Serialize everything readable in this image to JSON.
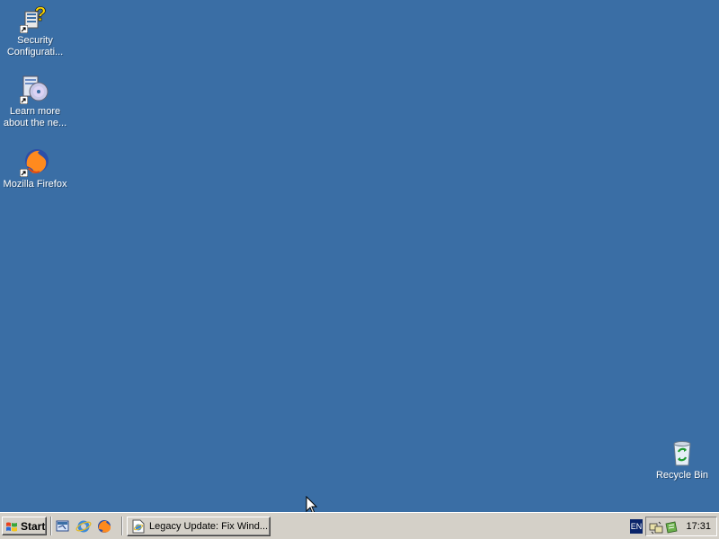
{
  "desktop": {
    "background_color": "#3a6ea5",
    "icons": [
      {
        "label": "Security\nConfigurati...",
        "icon": "security-configuration-wizard-icon"
      },
      {
        "label": "Learn more\nabout the ne...",
        "icon": "learn-more-cd-icon"
      },
      {
        "label": "Mozilla Firefox",
        "icon": "firefox-icon"
      },
      {
        "label": "Recycle Bin",
        "icon": "recycle-bin-icon"
      }
    ]
  },
  "taskbar": {
    "start_label": "Start",
    "quick_launch": [
      "show-desktop-icon",
      "internet-explorer-icon",
      "firefox-icon"
    ],
    "tasks": [
      {
        "label": "Legacy Update: Fix Wind...",
        "icon": "ie-page-icon"
      }
    ],
    "language": "EN",
    "tray_icons": [
      "network-icon",
      "update-icon"
    ],
    "clock": "17:31"
  }
}
